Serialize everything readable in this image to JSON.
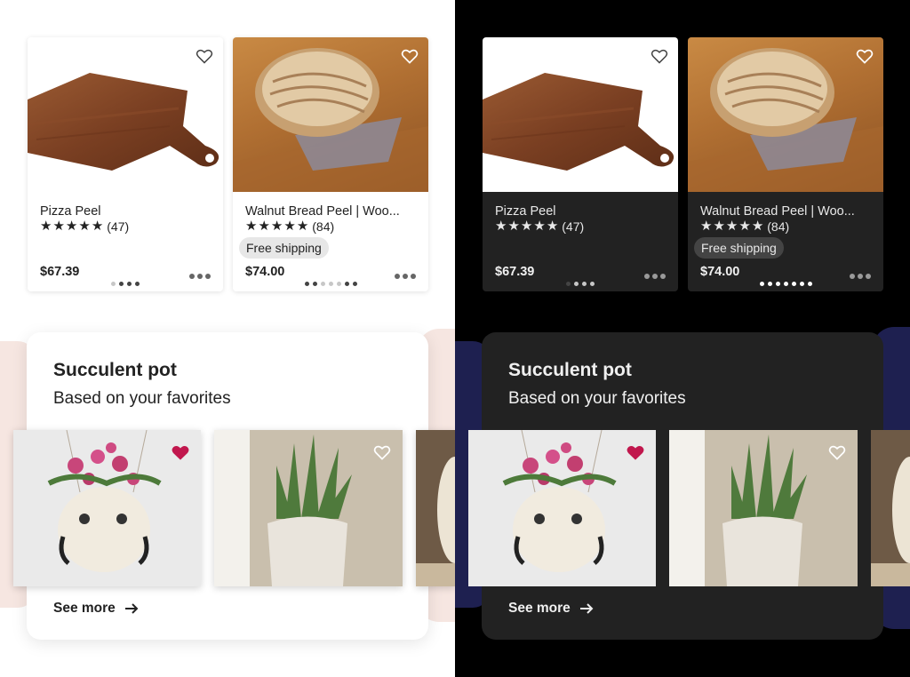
{
  "themes": [
    "light",
    "dark"
  ],
  "listings": [
    {
      "title": "Pizza Peel",
      "rating_stars": 5,
      "review_count": "(47)",
      "free_shipping": false,
      "price": "$67.39",
      "image": "pizza-peel-photo",
      "dots": 4,
      "active_dot": 1
    },
    {
      "title": "Walnut Bread Peel | Woo...",
      "rating_stars": 5,
      "review_count": "(84)",
      "free_shipping": true,
      "shipping_label": "Free shipping",
      "price": "$74.00",
      "image": "bread-peel-photo",
      "dots": 7,
      "active_dot": 6
    }
  ],
  "recommendation": {
    "title": "Succulent pot",
    "subtitle": "Based on your favorites",
    "see_more": "See more",
    "items": [
      {
        "image": "owl-planter-photo",
        "favorited": true
      },
      {
        "image": "succulent-pot-photo",
        "favorited": false
      },
      {
        "image": "cat-planter-photo",
        "favorited": false
      }
    ]
  },
  "colors": {
    "favorite_heart": "#c1174d",
    "light_background": "#ffffff",
    "dark_background": "#000000",
    "dark_card": "#222222",
    "light_blob": "#f6e6e1",
    "dark_blob": "#1e2050"
  },
  "icons": [
    "heart-outline-icon",
    "heart-filled-icon",
    "star-icon",
    "more-dots-icon",
    "arrow-right-icon"
  ]
}
